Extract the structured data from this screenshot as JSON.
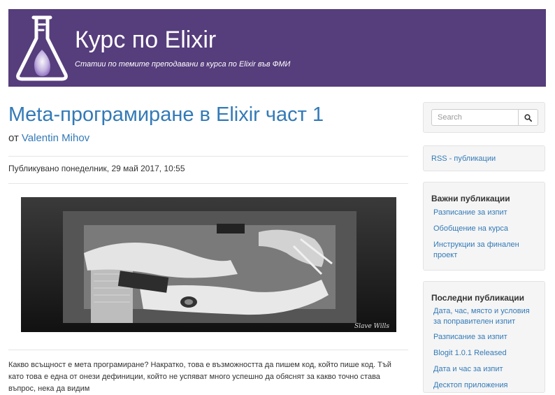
{
  "header": {
    "title": "Курс по Elixir",
    "subtitle": "Статии по темите преподавани в курса по Elixir във ФМИ",
    "logo_icon": "flask-icon",
    "background": "#563d7c"
  },
  "post": {
    "title": "Meta-програмиране в Elixir част 1",
    "byline_prefix": "от",
    "author": "Valentin Mihov",
    "published": "Публикувано понеделник, 29 май 2017, 10:55",
    "image_signature": "Slave Wills",
    "body": "Какво всъщност е мета програмиране? Накратко, това е възможността да пишем код, който пише код. Тъй като това е една от онези дефиниции, който не успяват много успешно да обяснят за какво точно става въпрос, нека да видим"
  },
  "sidebar": {
    "search": {
      "placeholder": "Search",
      "button_icon": "search-icon"
    },
    "rss_label": "RSS - публикации",
    "important": {
      "title": "Важни публикации",
      "items": [
        "Разписание за изпит",
        "Обобщение на курса",
        "Инструкции за финален проект"
      ]
    },
    "recent": {
      "title": "Последни публикации",
      "items": [
        "Дата, час, място и условия за поправителен изпит",
        "Разписание за изпит",
        "Blogit 1.0.1 Released",
        "Дата и час за изпит",
        "Десктоп приложения"
      ]
    }
  },
  "colors": {
    "link": "#337ab7",
    "text": "#333333",
    "well": "#f5f5f5"
  }
}
